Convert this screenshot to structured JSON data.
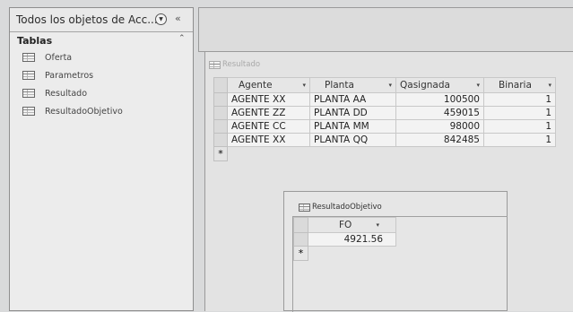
{
  "nav": {
    "title": "Todos los objetos de Acc...",
    "collapse_glyph": "«",
    "dropdown_glyph": "▼",
    "group": {
      "label": "Tablas",
      "chevron": "⌃"
    },
    "items": [
      {
        "label": "Oferta",
        "icon": "table-icon"
      },
      {
        "label": "Parametros",
        "icon": "table-icon"
      },
      {
        "label": "Resultado",
        "icon": "table-icon"
      },
      {
        "label": "ResultadoObjetivo",
        "icon": "table-icon"
      }
    ]
  },
  "resultado": {
    "title": "Resultado",
    "columns": [
      "Agente",
      "Planta",
      "Qasignada",
      "Binaria"
    ],
    "sort_glyph": "▾",
    "rows": [
      [
        "AGENTE XX",
        "PLANTA AA",
        "100500",
        "1"
      ],
      [
        "AGENTE ZZ",
        "PLANTA DD",
        "459015",
        "1"
      ],
      [
        "AGENTE CC",
        "PLANTA MM",
        "98000",
        "1"
      ],
      [
        "AGENTE XX",
        "PLANTA QQ",
        "842485",
        "1"
      ]
    ],
    "new_row_marker": "*"
  },
  "resultado_objetivo": {
    "title": "ResultadoObjetivo",
    "columns": [
      "FO"
    ],
    "rows": [
      [
        "4921.56"
      ]
    ],
    "new_row_marker": "*"
  }
}
